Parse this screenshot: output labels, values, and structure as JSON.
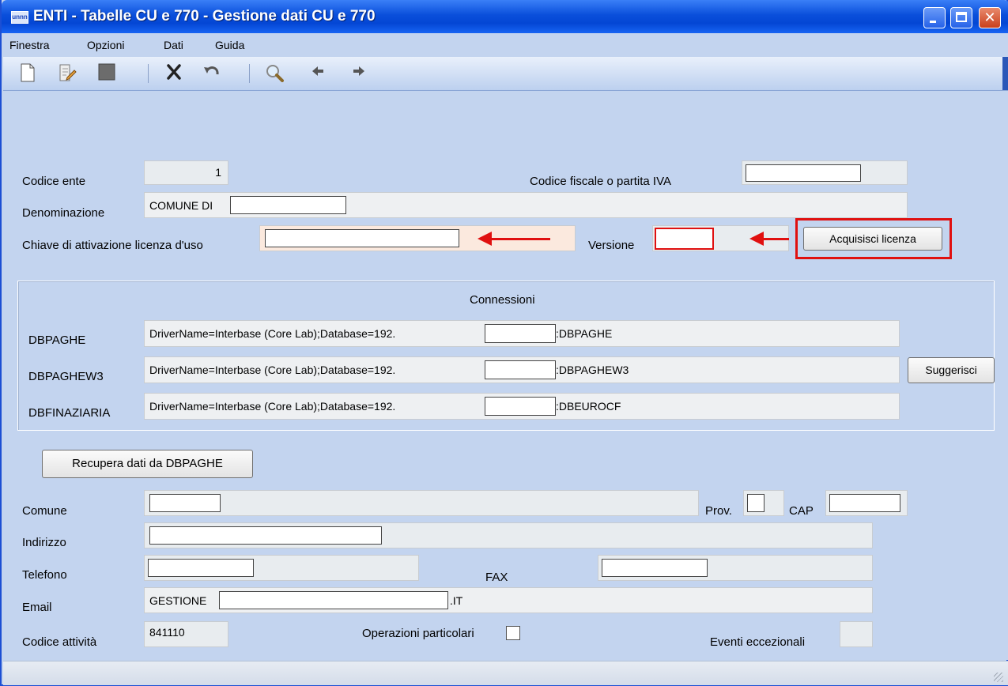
{
  "window": {
    "icon_text": "unnn",
    "title": "ENTI - Tabelle CU e 770 - Gestione dati CU e 770"
  },
  "menu": [
    "Finestra",
    "Opzioni",
    "Dati",
    "Guida"
  ],
  "toolbar": {
    "icons": [
      "new-document-icon",
      "edit-document-icon",
      "save-icon",
      "delete-icon",
      "undo-icon",
      "search-icon",
      "arrow-left-icon",
      "arrow-right-icon"
    ]
  },
  "form": {
    "codice_ente": {
      "label": "Codice ente",
      "value": "1"
    },
    "codice_fiscale": {
      "label": "Codice fiscale o partita IVA",
      "value": ""
    },
    "denominazione": {
      "label": "Denominazione",
      "value": "COMUNE DI"
    },
    "chiave": {
      "label": "Chiave di attivazione licenza d'uso",
      "value": ""
    },
    "versione": {
      "label": "Versione",
      "value": ""
    },
    "acquisisci_label": "Acquisisci licenza"
  },
  "connections": {
    "title": "Connessioni",
    "rows": [
      {
        "name": "DBPAGHE",
        "prefix": "DriverName=Interbase (Core Lab);Database=192.",
        "suffix": ":DBPAGHE"
      },
      {
        "name": "DBPAGHEW3",
        "prefix": "DriverName=Interbase (Core Lab);Database=192.",
        "suffix": ":DBPAGHEW3"
      },
      {
        "name": "DBFINAZIARIA",
        "prefix": "DriverName=Interbase (Core Lab);Database=192.",
        "suffix": ":DBEUROCF"
      }
    ],
    "suggerisci_label": "Suggerisci"
  },
  "recupera_label": "Recupera dati da DBPAGHE",
  "details": {
    "comune_label": "Comune",
    "prov_label": "Prov.",
    "cap_label": "CAP",
    "indirizzo_label": "Indirizzo",
    "telefono_label": "Telefono",
    "fax_label": "FAX",
    "email_label": "Email",
    "email_prefix": "GESTIONE",
    "email_suffix": ".IT",
    "codice_attivita_label": "Codice attività",
    "codice_attivita_value": "841110",
    "operazioni_label": "Operazioni particolari",
    "eventi_label": "Eventi eccezionali"
  },
  "colors": {
    "highlight": "#e01010",
    "title_bar": "#0a4fdb",
    "background": "#c3d4ef"
  }
}
